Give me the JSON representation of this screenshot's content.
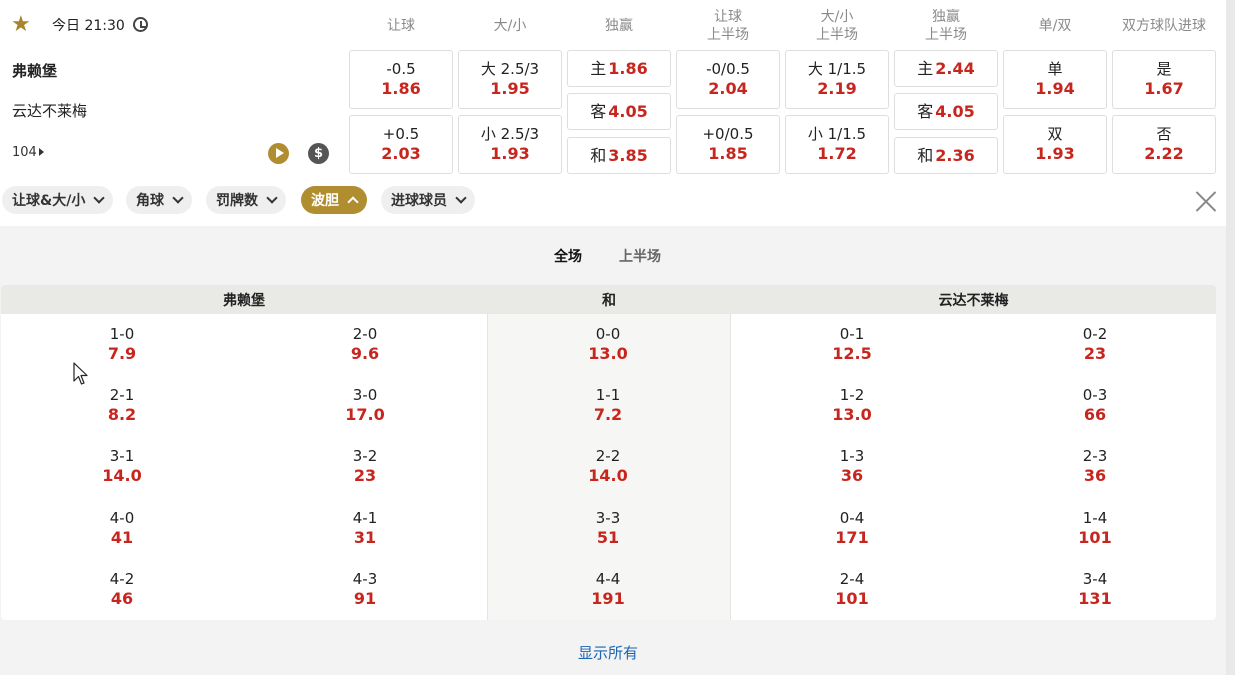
{
  "match": {
    "time": "今日 21:30",
    "home": "弗赖堡",
    "away": "云达不莱梅",
    "market_count": "104"
  },
  "columns": [
    "让球",
    "大/小",
    "独赢",
    "让球\n上半场",
    "大/小\n上半场",
    "独赢\n上半场",
    "单/双",
    "双方球队进球"
  ],
  "odds": {
    "handicap": [
      {
        "label": "-0.5",
        "value": "1.86"
      },
      {
        "label": "+0.5",
        "value": "2.03"
      }
    ],
    "over_under": [
      {
        "label": "大 2.5/3",
        "value": "1.95"
      },
      {
        "label": "小 2.5/3",
        "value": "1.93"
      }
    ],
    "moneyline": [
      {
        "label": "主",
        "value": "1.86"
      },
      {
        "label": "客",
        "value": "4.05"
      },
      {
        "label": "和",
        "value": "3.85"
      }
    ],
    "handicap_1h": [
      {
        "label": "-0/0.5",
        "value": "2.04"
      },
      {
        "label": "+0/0.5",
        "value": "1.85"
      }
    ],
    "over_under_1h": [
      {
        "label": "大 1/1.5",
        "value": "2.19"
      },
      {
        "label": "小 1/1.5",
        "value": "1.72"
      }
    ],
    "moneyline_1h": [
      {
        "label": "主",
        "value": "2.44"
      },
      {
        "label": "客",
        "value": "4.05"
      },
      {
        "label": "和",
        "value": "2.36"
      }
    ],
    "odd_even": [
      {
        "label": "单",
        "value": "1.94"
      },
      {
        "label": "双",
        "value": "1.93"
      }
    ],
    "btts": [
      {
        "label": "是",
        "value": "1.67"
      },
      {
        "label": "否",
        "value": "2.22"
      }
    ]
  },
  "filters": [
    {
      "label": "让球&大/小",
      "active": false
    },
    {
      "label": "角球",
      "active": false
    },
    {
      "label": "罚牌数",
      "active": false
    },
    {
      "label": "波胆",
      "active": true
    },
    {
      "label": "进球球员",
      "active": false
    }
  ],
  "correct_score": {
    "tabs": [
      "全场",
      "上半场"
    ],
    "headers": {
      "home": "弗赖堡",
      "draw": "和",
      "away": "云达不莱梅"
    },
    "home_col1": [
      {
        "s": "1-0",
        "o": "7.9"
      },
      {
        "s": "2-1",
        "o": "8.2"
      },
      {
        "s": "3-1",
        "o": "14.0"
      },
      {
        "s": "4-0",
        "o": "41"
      },
      {
        "s": "4-2",
        "o": "46"
      }
    ],
    "home_col2": [
      {
        "s": "2-0",
        "o": "9.6"
      },
      {
        "s": "3-0",
        "o": "17.0"
      },
      {
        "s": "3-2",
        "o": "23"
      },
      {
        "s": "4-1",
        "o": "31"
      },
      {
        "s": "4-3",
        "o": "91"
      }
    ],
    "draw": [
      {
        "s": "0-0",
        "o": "13.0"
      },
      {
        "s": "1-1",
        "o": "7.2"
      },
      {
        "s": "2-2",
        "o": "14.0"
      },
      {
        "s": "3-3",
        "o": "51"
      },
      {
        "s": "4-4",
        "o": "191"
      }
    ],
    "away_col1": [
      {
        "s": "0-1",
        "o": "12.5"
      },
      {
        "s": "1-2",
        "o": "13.0"
      },
      {
        "s": "1-3",
        "o": "36"
      },
      {
        "s": "0-4",
        "o": "171"
      },
      {
        "s": "2-4",
        "o": "101"
      }
    ],
    "away_col2": [
      {
        "s": "0-2",
        "o": "23"
      },
      {
        "s": "0-3",
        "o": "66"
      },
      {
        "s": "2-3",
        "o": "36"
      },
      {
        "s": "1-4",
        "o": "101"
      },
      {
        "s": "3-4",
        "o": "131"
      }
    ],
    "show_all": "显示所有"
  },
  "colors": {
    "accent": "#b08d2f",
    "odds": "#c7261e",
    "link": "#1a66b5"
  }
}
